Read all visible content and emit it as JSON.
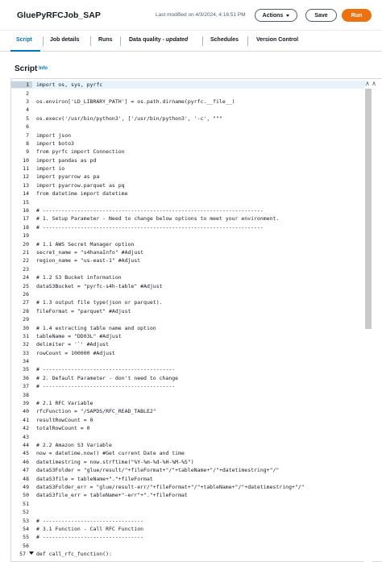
{
  "header": {
    "job_title": "GluePyRFCJob_SAP",
    "last_modified": "Last modified on 4/3/2024, 4:16:51 PM",
    "actions_label": "Actions",
    "save_label": "Save",
    "run_label": "Run"
  },
  "tabs": {
    "script": "Script",
    "job_details": "Job details",
    "runs": "Runs",
    "data_quality": "Data quality - ",
    "data_quality_tag": "updated",
    "schedules": "Schedules",
    "version_control": "Version Control"
  },
  "section": {
    "title": "Script",
    "info": "Info"
  },
  "editor": {
    "scroll_up_icons": "∧ ∧",
    "lines": [
      {
        "n": "1",
        "t": "import os, sys, pyrfc"
      },
      {
        "n": "2",
        "t": ""
      },
      {
        "n": "3",
        "t": "os.environ['LD_LIBRARY_PATH'] = os.path.dirname(pyrfc.__file__)"
      },
      {
        "n": "4",
        "t": ""
      },
      {
        "n": "5",
        "t": "os.execv('/usr/bin/python3', ['/usr/bin/python3', '-c', \"\"\""
      },
      {
        "n": "6",
        "t": ""
      },
      {
        "n": "7",
        "t": "import json"
      },
      {
        "n": "8",
        "t": "import boto3"
      },
      {
        "n": "9",
        "t": "from pyrfc import Connection"
      },
      {
        "n": "10",
        "t": "import pandas as pd"
      },
      {
        "n": "11",
        "t": "import io"
      },
      {
        "n": "12",
        "t": "import pyarrow as pa"
      },
      {
        "n": "13",
        "t": "import pyarrow.parquet as pq"
      },
      {
        "n": "14",
        "t": "from datetime import datetime"
      },
      {
        "n": "15",
        "t": ""
      },
      {
        "n": "16",
        "t": "# ----------------------------------------------------------------------"
      },
      {
        "n": "17",
        "t": "# 1. Setup Parameter - Need to change below options to meet your environment."
      },
      {
        "n": "18",
        "t": "# ----------------------------------------------------------------------"
      },
      {
        "n": "19",
        "t": ""
      },
      {
        "n": "20",
        "t": "# 1.1 AWS Secret Manager option"
      },
      {
        "n": "21",
        "t": "secret_name = \"s4hanaInfo\" #Adjust"
      },
      {
        "n": "22",
        "t": "region_name = \"us-east-1\" #Adjust"
      },
      {
        "n": "23",
        "t": ""
      },
      {
        "n": "24",
        "t": "# 1.2 S3 Bucket information"
      },
      {
        "n": "25",
        "t": "dataS3Bucket = \"pyrfc-s4h-table\" #Adjust"
      },
      {
        "n": "26",
        "t": ""
      },
      {
        "n": "27",
        "t": "# 1.3 output file type(json or parquet)."
      },
      {
        "n": "28",
        "t": "fileFormat = \"parquet\" #Adjust"
      },
      {
        "n": "29",
        "t": ""
      },
      {
        "n": "30",
        "t": "# 1.4 extracting table name and option"
      },
      {
        "n": "31",
        "t": "tableName = \"DD03L\" #Adjust"
      },
      {
        "n": "32",
        "t": "delimiter = '`' #Adjust"
      },
      {
        "n": "33",
        "t": "rowCount = 100000 #Adjust"
      },
      {
        "n": "34",
        "t": ""
      },
      {
        "n": "35",
        "t": "# ------------------------------------------"
      },
      {
        "n": "36",
        "t": "# 2. Default Parameter - don't need to change"
      },
      {
        "n": "37",
        "t": "# ------------------------------------------"
      },
      {
        "n": "38",
        "t": ""
      },
      {
        "n": "39",
        "t": "# 2.1 RFC Variable"
      },
      {
        "n": "40",
        "t": "rfcFunction = \"/SAPDS/RFC_READ_TABLE2\""
      },
      {
        "n": "41",
        "t": "resultRowCount = 0"
      },
      {
        "n": "42",
        "t": "totalRowCount = 0"
      },
      {
        "n": "43",
        "t": ""
      },
      {
        "n": "44",
        "t": "# 2.2 Amazon S3 Variable"
      },
      {
        "n": "45",
        "t": "now = datetime.now() #Get current Date and time"
      },
      {
        "n": "46",
        "t": "datetimestring = now.strftime(\"%Y-%m-%d-%H-%M-%S\")"
      },
      {
        "n": "47",
        "t": "dataS3Folder = \"glue/result/\"+fileFormat+\"/\"+tableName+\"/\"+datetimestring+\"/\""
      },
      {
        "n": "48",
        "t": "dataS3file = tableName+\".\"+fileFormat"
      },
      {
        "n": "49",
        "t": "dataS3Folder_err = \"glue/result-err/\"+fileFormat+\"/\"+tableName+\"/\"+datetimestring+\"/\""
      },
      {
        "n": "50",
        "t": "dataS3file_err = tableName+\"-err\"+\".\"+fileFormat"
      },
      {
        "n": "51",
        "t": ""
      },
      {
        "n": "52",
        "t": ""
      },
      {
        "n": "53",
        "t": "# --------------------------------"
      },
      {
        "n": "54",
        "t": "# 3.1 Function - Call RFC Function"
      },
      {
        "n": "55",
        "t": "# --------------------------------"
      },
      {
        "n": "56",
        "t": ""
      },
      {
        "n": "57",
        "t": "def call_rfc_function():"
      }
    ]
  }
}
